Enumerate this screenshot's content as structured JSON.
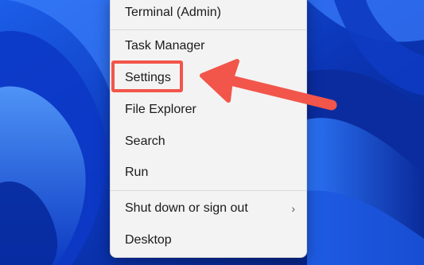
{
  "menu": {
    "items": [
      {
        "label": "Terminal (Admin)"
      },
      {
        "label": "Task Manager"
      },
      {
        "label": "Settings"
      },
      {
        "label": "File Explorer"
      },
      {
        "label": "Search"
      },
      {
        "label": "Run"
      },
      {
        "label": "Shut down or sign out",
        "chevron": "›"
      },
      {
        "label": "Desktop"
      }
    ]
  },
  "colors": {
    "highlight": "#f2554a",
    "wallpaper": "#0a2f9e",
    "menu_bg": "#f3f3f3"
  },
  "icons": {
    "submenu": "chevron-right-icon",
    "pointer": "red-arrow-icon"
  }
}
